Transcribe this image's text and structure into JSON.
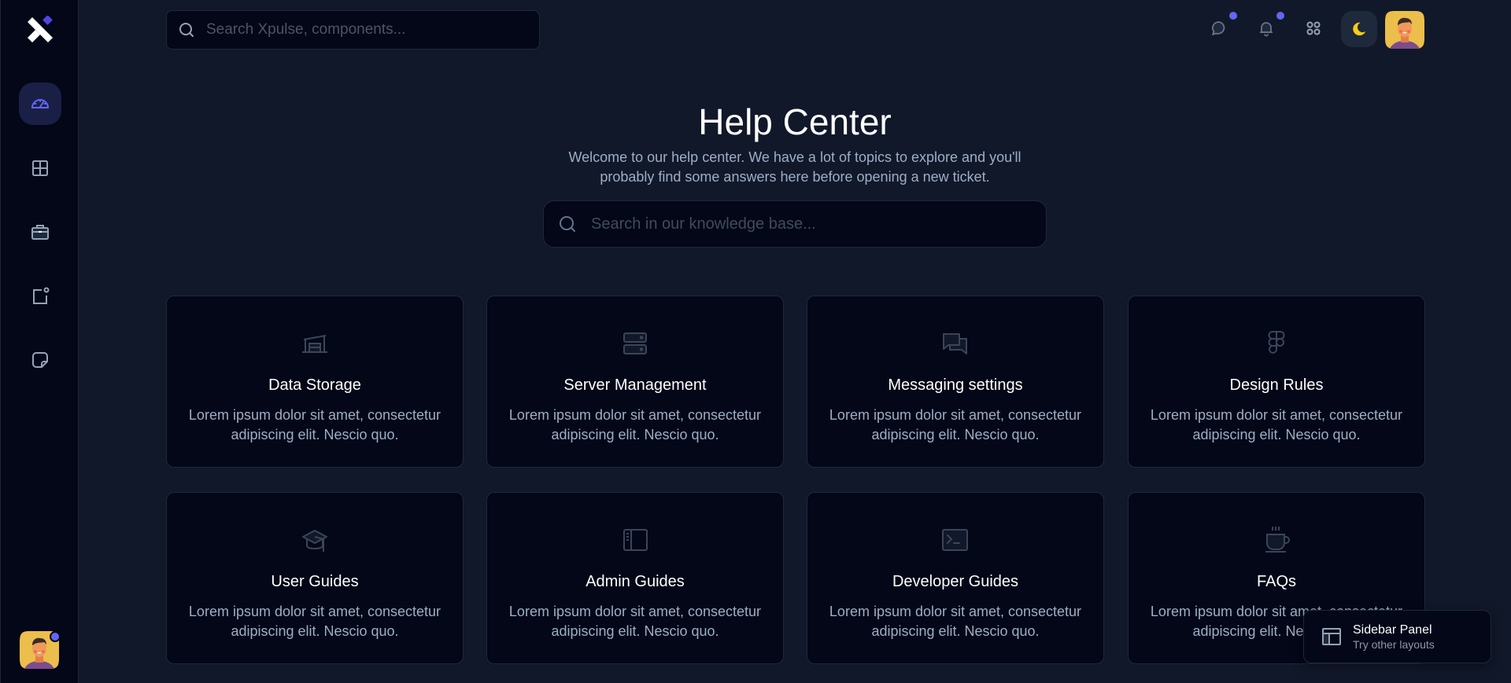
{
  "app": {
    "brand": "Xpulse",
    "accent_color": "#6366f1",
    "theme_icon_color": "#facc15"
  },
  "sidebar": {
    "logo_icon": "x-logo-icon",
    "items": [
      {
        "name": "dashboard",
        "icon": "speedometer-icon",
        "active": true
      },
      {
        "name": "layouts",
        "icon": "grid-icon",
        "active": false
      },
      {
        "name": "briefcase",
        "icon": "briefcase-icon",
        "active": false
      },
      {
        "name": "notifications-square",
        "icon": "square-dot-icon",
        "active": false
      },
      {
        "name": "notes",
        "icon": "sticky-note-icon",
        "active": false
      }
    ],
    "avatar": {
      "has_status_dot": true
    }
  },
  "topbar": {
    "search": {
      "placeholder": "Search Xpulse, components...",
      "value": ""
    },
    "icons": [
      {
        "name": "messages",
        "icon": "chat-bubble-icon",
        "has_badge": true
      },
      {
        "name": "notifications",
        "icon": "bell-icon",
        "has_badge": true
      },
      {
        "name": "apps",
        "icon": "apps-grid-icon",
        "has_badge": false
      }
    ],
    "theme_toggle": {
      "icon": "moon-icon",
      "mode": "dark"
    }
  },
  "header": {
    "title": "Help Center",
    "subtitle": "Welcome to our help center. We have a lot of topics to explore and you'll probably find some answers here before opening a new ticket.",
    "search": {
      "placeholder": "Search in our knowledge base...",
      "value": ""
    }
  },
  "cards": [
    {
      "title": "Data Storage",
      "description": "Lorem ipsum dolor sit amet, consectetur adipiscing elit. Nescio quo.",
      "icon": "warehouse-icon"
    },
    {
      "title": "Server Management",
      "description": "Lorem ipsum dolor sit amet, consectetur adipiscing elit. Nescio quo.",
      "icon": "server-icon"
    },
    {
      "title": "Messaging settings",
      "description": "Lorem ipsum dolor sit amet, consectetur adipiscing elit. Nescio quo.",
      "icon": "chat-bubbles-icon"
    },
    {
      "title": "Design Rules",
      "description": "Lorem ipsum dolor sit amet, consectetur adipiscing elit. Nescio quo.",
      "icon": "figma-icon"
    },
    {
      "title": "User Guides",
      "description": "Lorem ipsum dolor sit amet, consectetur adipiscing elit. Nescio quo.",
      "icon": "graduation-cap-icon"
    },
    {
      "title": "Admin Guides",
      "description": "Lorem ipsum dolor sit amet, consectetur adipiscing elit. Nescio quo.",
      "icon": "sidebar-layout-icon"
    },
    {
      "title": "Developer Guides",
      "description": "Lorem ipsum dolor sit amet, consectetur adipiscing elit. Nescio quo.",
      "icon": "terminal-icon"
    },
    {
      "title": "FAQs",
      "description": "Lorem ipsum dolor sit amet, consectetur adipiscing elit. Nescio quo.",
      "icon": "coffee-cup-icon"
    }
  ],
  "floating_panel": {
    "title": "Sidebar Panel",
    "subtitle": "Try other layouts",
    "icon": "layout-icon"
  }
}
